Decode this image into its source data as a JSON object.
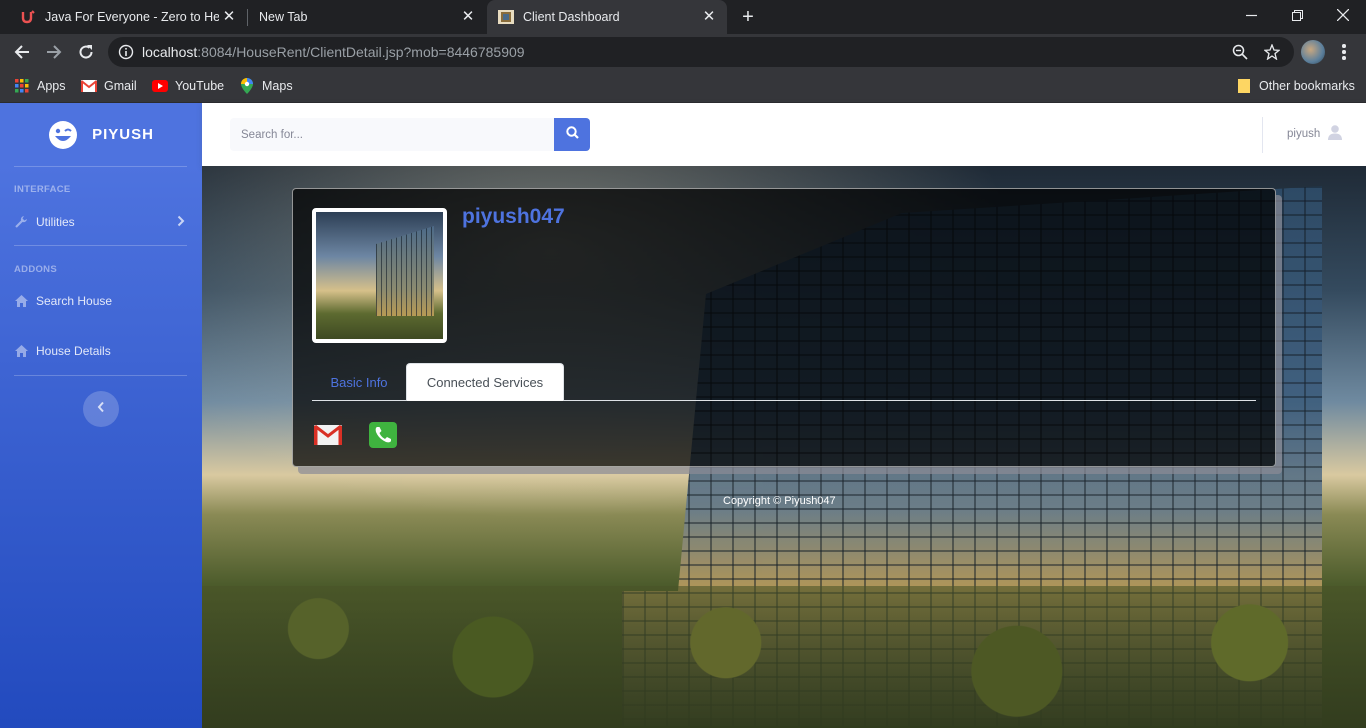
{
  "browser": {
    "tabs": [
      {
        "title": "Java For Everyone - Zero to Hero",
        "favicon": "udemy-icon",
        "active": false
      },
      {
        "title": "New Tab",
        "favicon": "none",
        "active": false
      },
      {
        "title": "Client Dashboard",
        "favicon": "building-thumbnail-icon",
        "active": true
      }
    ],
    "url_host": "localhost",
    "url_rest": ":8084/HouseRent/ClientDetail.jsp?mob=8446785909",
    "bookmarks": [
      {
        "label": "Apps",
        "icon": "apps-grid-icon"
      },
      {
        "label": "Gmail",
        "icon": "gmail-icon"
      },
      {
        "label": "YouTube",
        "icon": "youtube-icon"
      },
      {
        "label": "Maps",
        "icon": "maps-icon"
      }
    ],
    "other_bookmarks": "Other bookmarks"
  },
  "sidebar": {
    "brand": "PIYUSH",
    "sections": [
      {
        "heading": "INTERFACE",
        "items": [
          {
            "label": "Utilities",
            "icon": "wrench-icon"
          }
        ]
      },
      {
        "heading": "ADDONS",
        "items": [
          {
            "label": "Search House",
            "icon": "home-icon"
          },
          {
            "label": "House Details",
            "icon": "home-icon"
          }
        ]
      }
    ]
  },
  "topbar": {
    "search_placeholder": "Search for...",
    "username": "piyush"
  },
  "profile": {
    "name": "piyush047",
    "tabs": [
      {
        "label": "Basic Info",
        "active": false
      },
      {
        "label": "Connected Services",
        "active": true
      }
    ],
    "services": [
      {
        "icon": "gmail-icon"
      },
      {
        "icon": "phone-icon"
      }
    ]
  },
  "footer": {
    "text": "Copyright © Piyush047"
  },
  "colors": {
    "primary": "#4e73df",
    "sidebar_gradient_end": "#224abe",
    "chrome_dark": "#202124",
    "chrome_toolbar": "#35363a"
  }
}
